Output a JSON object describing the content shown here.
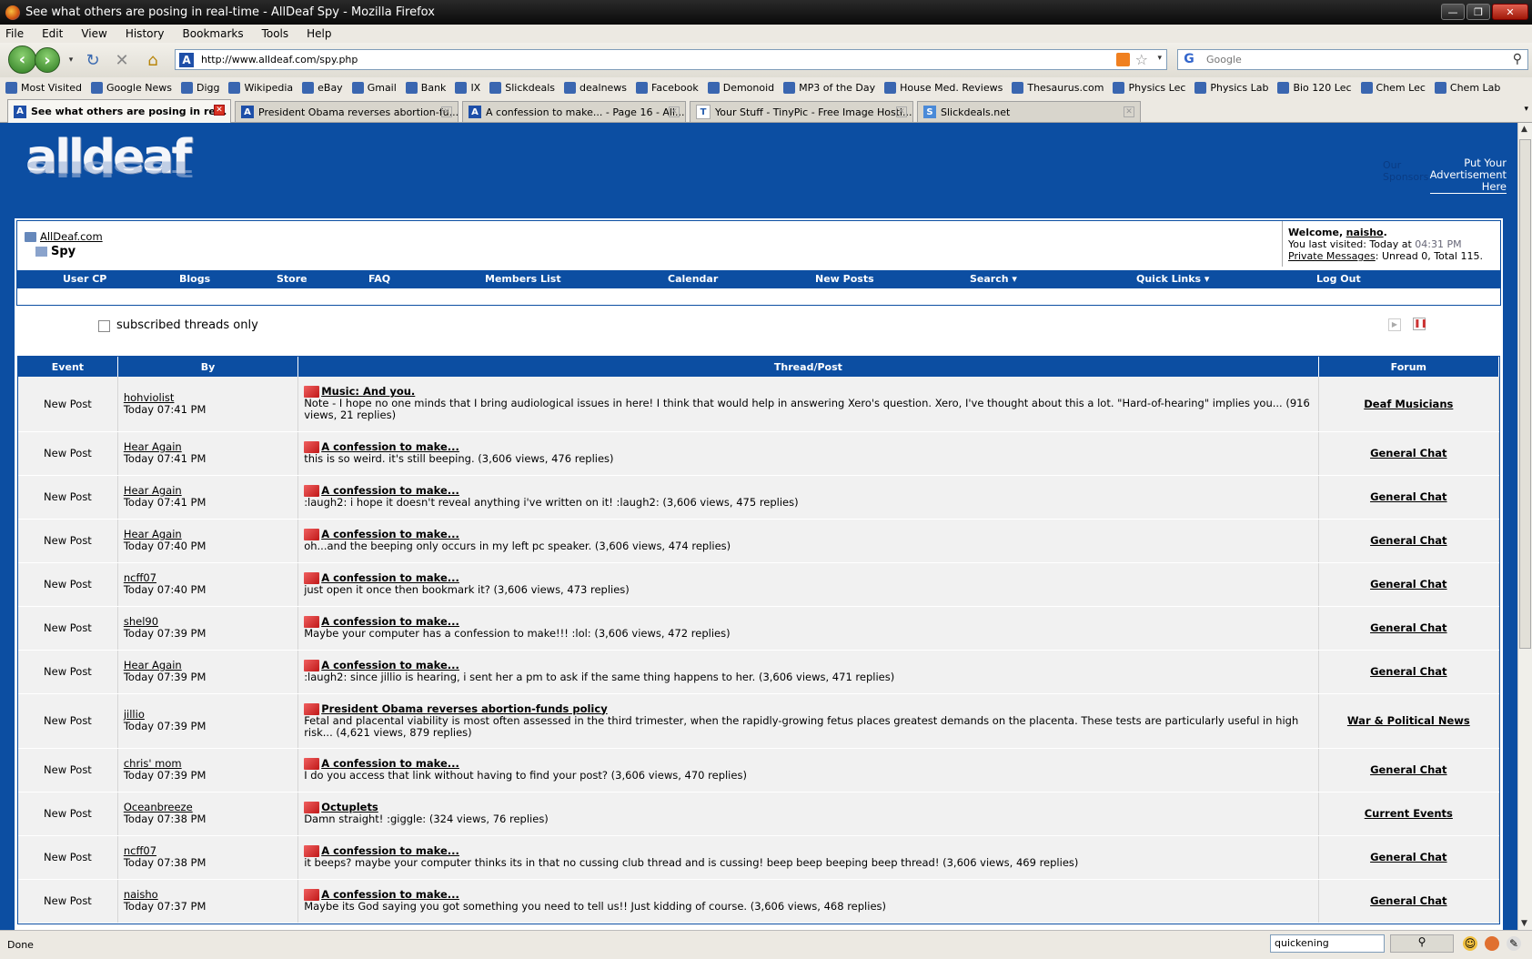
{
  "window": {
    "title": "See what others are posing in real-time - AllDeaf Spy - Mozilla Firefox",
    "buttons": [
      "—",
      "❐",
      "✕"
    ]
  },
  "menu": [
    "File",
    "Edit",
    "View",
    "History",
    "Bookmarks",
    "Tools",
    "Help"
  ],
  "nav": {
    "url": "http://www.alldeaf.com/spy.php",
    "search_placeholder": "Google"
  },
  "bookmarks": [
    "Most Visited",
    "Google News",
    "Digg",
    "Wikipedia",
    "eBay",
    "Gmail",
    "Bank",
    "IX",
    "Slickdeals",
    "dealnews",
    "Facebook",
    "Demonoid",
    "MP3 of the Day",
    "House Med. Reviews",
    "Thesaurus.com",
    "Physics Lec",
    "Physics Lab",
    "Bio 120 Lec",
    "Chem Lec",
    "Chem Lab"
  ],
  "tabs": [
    {
      "label": "See what others are posing in re...",
      "active": true
    },
    {
      "label": "President Obama reverses abortion-fu...",
      "active": false
    },
    {
      "label": "A confession to make... - Page 16 - All...",
      "active": false
    },
    {
      "label": "Your Stuff - TinyPic - Free Image Hosti...",
      "active": false
    },
    {
      "label": "Slickdeals.net",
      "active": false
    }
  ],
  "site": {
    "logo": "alldeaf",
    "sponsors": "Our Sponsors",
    "advert": [
      "Put Your",
      "Advertisement",
      "Here"
    ]
  },
  "breadcrumb": {
    "root": "AllDeaf.com",
    "current": "Spy"
  },
  "welcome": {
    "welcome_label": "Welcome,",
    "username": "naisho",
    "punct": ".",
    "last_visit_label": "You last visited: Today at",
    "last_visit_time": "04:31 PM",
    "pm_link": "Private Messages",
    "pm_stats": ": Unread 0, Total 115."
  },
  "navlinks": [
    "User CP",
    "Blogs",
    "Store",
    "FAQ",
    "Members List",
    "Calendar",
    "New Posts",
    "Search ▾",
    "Quick Links ▾",
    "Log Out"
  ],
  "filter": {
    "subscribed_label": "subscribed threads only"
  },
  "table": {
    "headers": [
      "Event",
      "By",
      "Thread/Post",
      "Forum"
    ],
    "rows": [
      {
        "event": "New Post",
        "user": "hohviolist",
        "time": "Today 07:41 PM",
        "thread": "Music: And you.",
        "excerpt": "Note - I hope no one minds that I bring audiological issues in here! I think that would help in answering Xero's question. Xero, I've thought about this a lot. \"Hard-of-hearing\" implies you... (916 views, 21 replies)",
        "forum": "Deaf Musicians"
      },
      {
        "event": "New Post",
        "user": "Hear Again",
        "time": "Today 07:41 PM",
        "thread": "A confession to make...",
        "excerpt": "this is so weird. it's still beeping. (3,606 views, 476 replies)",
        "forum": "General Chat"
      },
      {
        "event": "New Post",
        "user": "Hear Again",
        "time": "Today 07:41 PM",
        "thread": "A confession to make...",
        "excerpt": ":laugh2: i hope it doesn't reveal anything i've written on it! :laugh2: (3,606 views, 475 replies)",
        "forum": "General Chat"
      },
      {
        "event": "New Post",
        "user": "Hear Again",
        "time": "Today 07:40 PM",
        "thread": "A confession to make...",
        "excerpt": "oh...and the beeping only occurs in my left pc speaker. (3,606 views, 474 replies)",
        "forum": "General Chat"
      },
      {
        "event": "New Post",
        "user": "ncff07",
        "time": "Today 07:40 PM",
        "thread": "A confession to make...",
        "excerpt": "just open it once then bookmark it? (3,606 views, 473 replies)",
        "forum": "General Chat"
      },
      {
        "event": "New Post",
        "user": "shel90",
        "time": "Today 07:39 PM",
        "thread": "A confession to make...",
        "excerpt": "Maybe your computer has a confession to make!!! :lol: (3,606 views, 472 replies)",
        "forum": "General Chat"
      },
      {
        "event": "New Post",
        "user": "Hear Again",
        "time": "Today 07:39 PM",
        "thread": "A confession to make...",
        "excerpt": ":laugh2: since jillio is hearing, i sent her a pm to ask if the same thing happens to her. (3,606 views, 471 replies)",
        "forum": "General Chat"
      },
      {
        "event": "New Post",
        "user": "jillio",
        "time": "Today 07:39 PM",
        "thread": "President Obama reverses abortion-funds policy",
        "excerpt": "Fetal and placental viability is most often assessed in the third trimester, when the rapidly-growing fetus places greatest demands on the placenta. These tests are particularly useful in high risk... (4,621 views, 879 replies)",
        "forum": "War & Political News"
      },
      {
        "event": "New Post",
        "user": "chris' mom",
        "time": "Today 07:39 PM",
        "thread": "A confession to make...",
        "excerpt": "I do you access that link without having to find your post? (3,606 views, 470 replies)",
        "forum": "General Chat"
      },
      {
        "event": "New Post",
        "user": "Oceanbreeze",
        "time": "Today 07:38 PM",
        "thread": "Octuplets",
        "excerpt": "Damn straight! :giggle: (324 views, 76 replies)",
        "forum": "Current Events"
      },
      {
        "event": "New Post",
        "user": "ncff07",
        "time": "Today 07:38 PM",
        "thread": "A confession to make...",
        "excerpt": "it beeps? maybe your computer thinks its in that no cussing club thread and is cussing! beep beep beeping beep thread! (3,606 views, 469 replies)",
        "forum": "General Chat"
      },
      {
        "event": "New Post",
        "user": "naisho",
        "time": "Today 07:37 PM",
        "thread": "A confession to make...",
        "excerpt": "Maybe its God saying you got something you need to tell us!! Just kidding of course. (3,606 views, 468 replies)",
        "forum": "General Chat"
      }
    ]
  },
  "status": {
    "text": "Done",
    "find_value": "quickening"
  },
  "colors": {
    "brand_blue": "#0c4ea2",
    "row_bg": "#f1f1f1"
  }
}
